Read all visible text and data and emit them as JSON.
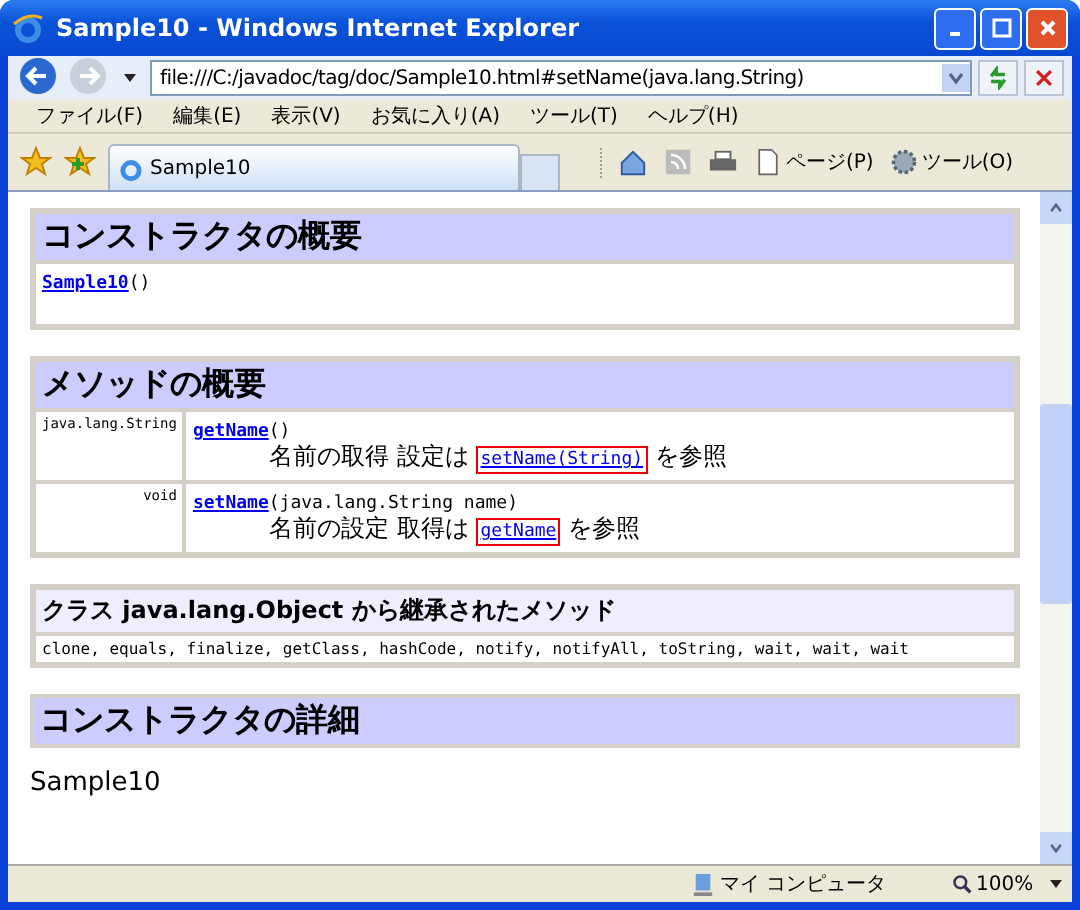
{
  "window": {
    "title": "Sample10 - Windows Internet Explorer"
  },
  "address_bar": {
    "value": "file:///C:/javadoc/tag/doc/Sample10.html#setName(java.lang.String)"
  },
  "menu": [
    "ファイル(F)",
    "編集(E)",
    "表示(V)",
    "お気に入り(A)",
    "ツール(T)",
    "ヘルプ(H)"
  ],
  "tabs": [
    {
      "label": "Sample10",
      "selected": true
    }
  ],
  "command_bar": [
    {
      "kind": "home"
    },
    {
      "kind": "feed"
    },
    {
      "kind": "print"
    },
    {
      "kind": "page",
      "label": "ページ(P)"
    },
    {
      "kind": "tools",
      "label": "ツール(O)"
    }
  ],
  "constructor_summary": {
    "heading": "コンストラクタの概要",
    "rows": [
      {
        "link": "Sample10",
        "signature": "()"
      }
    ]
  },
  "method_summary": {
    "heading": "メソッドの概要",
    "rows": [
      {
        "type": "java.lang.String",
        "link": "getName",
        "signature": "()",
        "description": "名前の取得 設定は",
        "ref": "setName(String)",
        "ref_tail": "を参照",
        "highlighted": true
      },
      {
        "type": "void",
        "link": "setName",
        "signature": "(java.lang.String name)",
        "description": "名前の設定 取得は",
        "ref": "getName",
        "ref_tail": "を参照",
        "highlighted": true
      }
    ]
  },
  "inherited": {
    "heading": "クラス java.lang.Object から継承されたメソッド",
    "methods": "clone, equals, finalize, getClass, hashCode, notify, notifyAll, toString, wait, wait, wait"
  },
  "constructor_detail": {
    "heading": "コンストラクタの詳細",
    "name": "Sample10"
  },
  "status_bar": {
    "zone": "マイ コンピュータ",
    "zoom": "100%"
  }
}
